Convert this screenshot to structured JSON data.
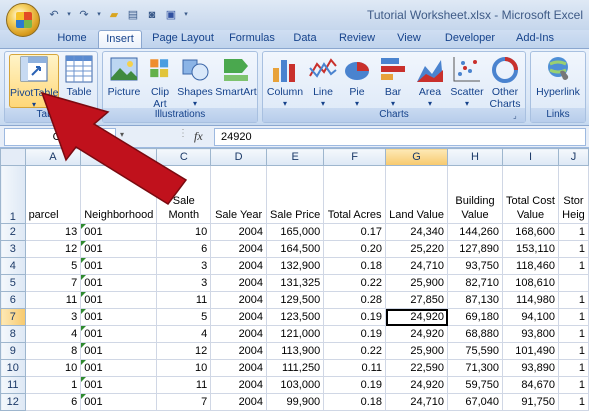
{
  "window": {
    "title": "Tutorial Worksheet.xlsx - Microsoft Excel"
  },
  "quick_access": [
    "undo",
    "redo",
    "open",
    "print-preview",
    "camera",
    "save",
    "customize"
  ],
  "tabs": [
    "Home",
    "Insert",
    "Page Layout",
    "Formulas",
    "Data",
    "Review",
    "View",
    "Developer",
    "Add-Ins"
  ],
  "active_tab": "Insert",
  "ribbon": {
    "groups": [
      {
        "label": "Tables",
        "buttons": [
          "PivotTable",
          "Table"
        ]
      },
      {
        "label": "Illustrations",
        "buttons": [
          "Picture",
          "Clip Art",
          "Shapes",
          "SmartArt"
        ]
      },
      {
        "label": "Charts",
        "buttons": [
          "Column",
          "Line",
          "Pie",
          "Bar",
          "Area",
          "Scatter",
          "Other Charts"
        ]
      },
      {
        "label": "Links",
        "buttons": [
          "Hyperlink"
        ]
      }
    ],
    "labels": {
      "pivottable": "PivotTable",
      "table": "Table",
      "picture": "Picture",
      "clipart1": "Clip",
      "clipart2": "Art",
      "shapes": "Shapes",
      "smartart": "SmartArt",
      "column": "Column",
      "line": "Line",
      "pie": "Pie",
      "bar": "Bar",
      "area": "Area",
      "scatter": "Scatter",
      "other1": "Other",
      "other2": "Charts",
      "hyperlink": "Hyperlink"
    }
  },
  "formula_bar": {
    "name_box": "G7",
    "fx": "fx",
    "value": "24920"
  },
  "grid": {
    "columns": [
      "A",
      "B",
      "C",
      "D",
      "E",
      "F",
      "G",
      "H",
      "I",
      "J"
    ],
    "selected_column": "G",
    "selected_row": 7,
    "headers": {
      "A": [
        "parcel"
      ],
      "B": [
        "Neighborhood"
      ],
      "C": [
        "Sale",
        "Month"
      ],
      "D": [
        "Sale Year"
      ],
      "E": [
        "Sale Price"
      ],
      "F": [
        "Total Acres"
      ],
      "G": [
        "Land Value"
      ],
      "H": [
        "Building",
        "Value"
      ],
      "I": [
        "Total Cost",
        "Value"
      ],
      "J": [
        "Stor",
        "Heig"
      ]
    },
    "rows": [
      {
        "n": "2",
        "cells": [
          "13",
          "001",
          "10",
          "2004",
          "165,000",
          "0.17",
          "24,340",
          "144,260",
          "168,600",
          "1"
        ]
      },
      {
        "n": "3",
        "cells": [
          "12",
          "001",
          "6",
          "2004",
          "164,500",
          "0.20",
          "25,220",
          "127,890",
          "153,110",
          "1"
        ]
      },
      {
        "n": "4",
        "cells": [
          "5",
          "001",
          "3",
          "2004",
          "132,900",
          "0.18",
          "24,710",
          "93,750",
          "118,460",
          "1"
        ]
      },
      {
        "n": "5",
        "cells": [
          "7",
          "001",
          "3",
          "2004",
          "131,325",
          "0.22",
          "25,900",
          "82,710",
          "108,610",
          ""
        ]
      },
      {
        "n": "6",
        "cells": [
          "11",
          "001",
          "11",
          "2004",
          "129,500",
          "0.28",
          "27,850",
          "87,130",
          "114,980",
          "1"
        ]
      },
      {
        "n": "7",
        "cells": [
          "3",
          "001",
          "5",
          "2004",
          "123,500",
          "0.19",
          "24,920",
          "69,180",
          "94,100",
          "1"
        ]
      },
      {
        "n": "8",
        "cells": [
          "4",
          "001",
          "4",
          "2004",
          "121,000",
          "0.19",
          "24,920",
          "68,880",
          "93,800",
          "1"
        ]
      },
      {
        "n": "9",
        "cells": [
          "8",
          "001",
          "12",
          "2004",
          "113,900",
          "0.22",
          "25,900",
          "75,590",
          "101,490",
          "1"
        ]
      },
      {
        "n": "10",
        "cells": [
          "10",
          "001",
          "10",
          "2004",
          "111,250",
          "0.11",
          "22,590",
          "71,300",
          "93,890",
          "1"
        ]
      },
      {
        "n": "11",
        "cells": [
          "1",
          "001",
          "11",
          "2004",
          "103,000",
          "0.19",
          "24,920",
          "59,750",
          "84,670",
          "1"
        ]
      },
      {
        "n": "12",
        "cells": [
          "6",
          "001",
          "7",
          "2004",
          "99,900",
          "0.18",
          "24,710",
          "67,040",
          "91,750",
          "1"
        ]
      }
    ]
  },
  "colors": {
    "arrow": "#c0111c",
    "ribbon_bg": "#dbe7f6",
    "selection_header": "#f7c96d"
  }
}
